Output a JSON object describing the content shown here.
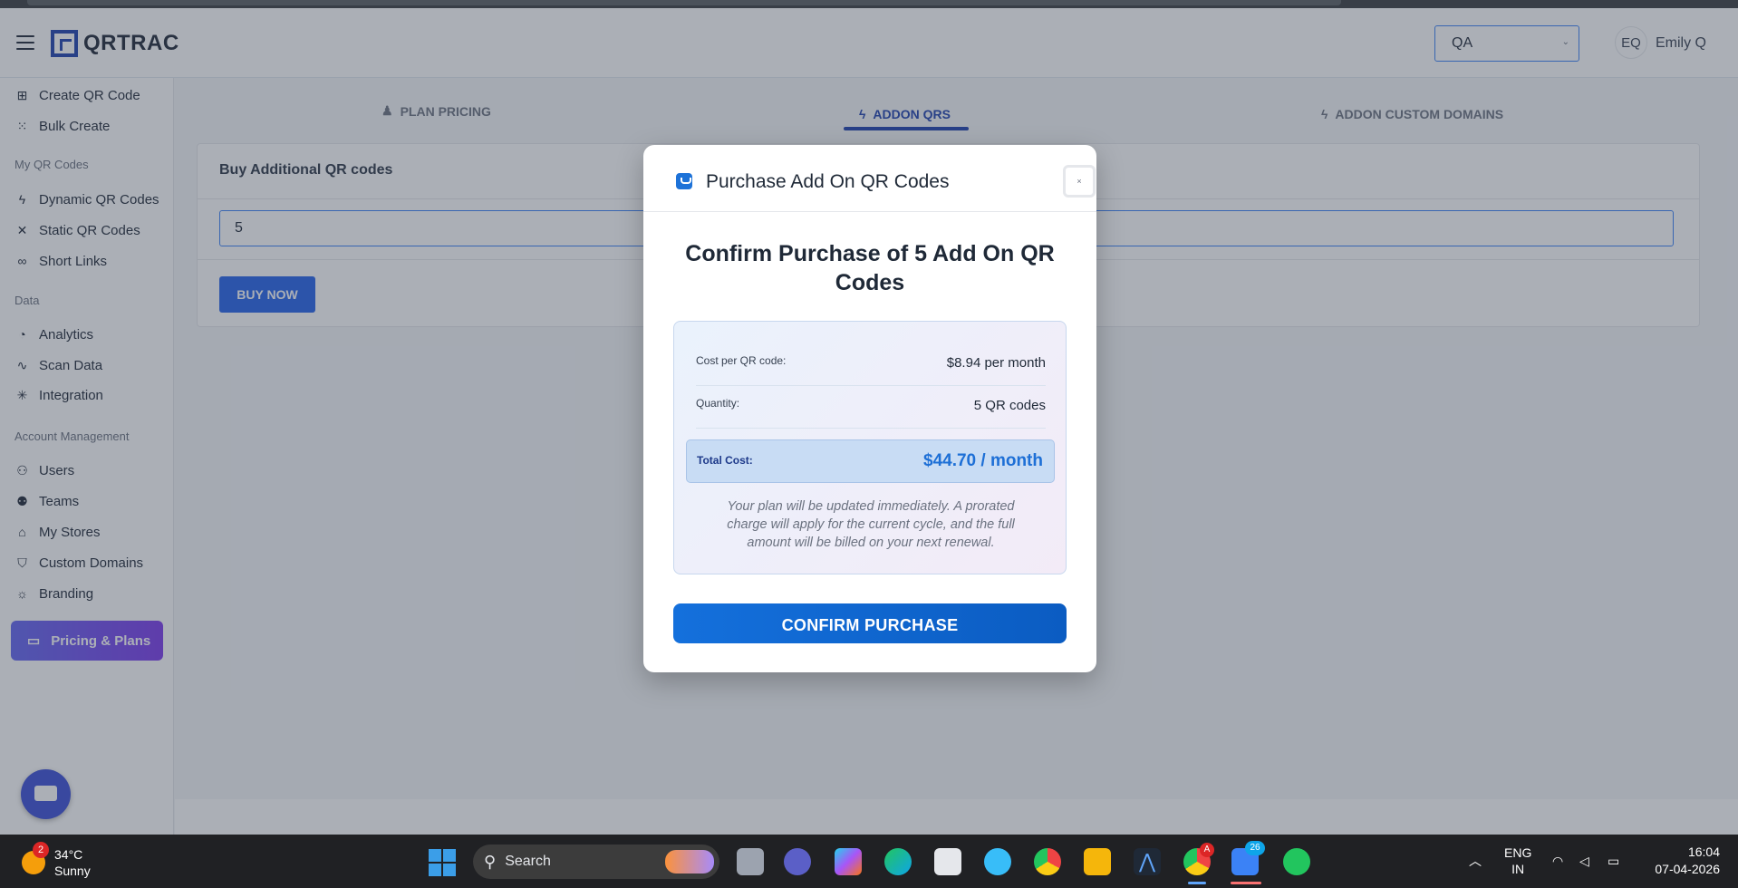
{
  "header": {
    "logo_text": "QRTRAC",
    "org_select": {
      "value": "QA"
    },
    "user": {
      "initials": "EQ",
      "name": "Emily Q"
    }
  },
  "sidebar": {
    "items_top": [
      {
        "label": "Create QR Code",
        "icon": "plus-square-icon"
      },
      {
        "label": "Bulk Create",
        "icon": "grid-icon"
      }
    ],
    "section_qr": "My QR Codes",
    "items_qr": [
      {
        "label": "Dynamic QR Codes",
        "icon": "bolt-icon"
      },
      {
        "label": "Static QR Codes",
        "icon": "crossed-pins-icon"
      },
      {
        "label": "Short Links",
        "icon": "link-icon"
      }
    ],
    "section_data": "Data",
    "items_data": [
      {
        "label": "Analytics",
        "icon": "pie-chart-icon"
      },
      {
        "label": "Scan Data",
        "icon": "activity-icon"
      },
      {
        "label": "Integration",
        "icon": "hub-icon"
      }
    ],
    "section_account": "Account Management",
    "items_account": [
      {
        "label": "Users",
        "icon": "user-plus-icon"
      },
      {
        "label": "Teams",
        "icon": "team-icon"
      },
      {
        "label": "My Stores",
        "icon": "store-icon"
      },
      {
        "label": "Custom Domains",
        "icon": "shield-icon"
      },
      {
        "label": "Branding",
        "icon": "sun-icon"
      }
    ],
    "pricing_button": "Pricing & Plans"
  },
  "main": {
    "tabs": [
      {
        "label": "PLAN PRICING",
        "active": false
      },
      {
        "label": "ADDON QRS",
        "active": true
      },
      {
        "label": "ADDON CUSTOM DOMAINS",
        "active": false
      }
    ],
    "card_title": "Buy Additional QR codes",
    "quantity_value": "5",
    "buy_button": "BUY NOW"
  },
  "modal": {
    "title": "Purchase Add On QR Codes",
    "close_label": "×",
    "heading": "Confirm Purchase of 5 Add On QR Codes",
    "cost_label": "Cost per QR code:",
    "cost_value": "$8.94 per month",
    "quantity_label": "Quantity:",
    "quantity_value": "5 QR codes",
    "total_label": "Total Cost:",
    "total_value": "$44.70 / month",
    "note": "Your plan will be updated immediately. A prorated charge will apply for the current cycle, and the full amount will be billed on your next renewal.",
    "confirm_button": "CONFIRM PURCHASE"
  },
  "taskbar": {
    "weather_temp": "34°C",
    "weather_desc": "Sunny",
    "weather_badge": "2",
    "search_placeholder": "Search",
    "chrome_badge": "A",
    "app_badge": "26",
    "lang_line1": "ENG",
    "lang_line2": "IN",
    "time": "16:04",
    "date": "07-04-2026"
  },
  "colors": {
    "brand": "#1e40af",
    "primary": "#2563eb",
    "pricing_gradient_start": "#6366f1",
    "pricing_gradient_end": "#7c3aed",
    "total_text": "#1d6fd6"
  }
}
